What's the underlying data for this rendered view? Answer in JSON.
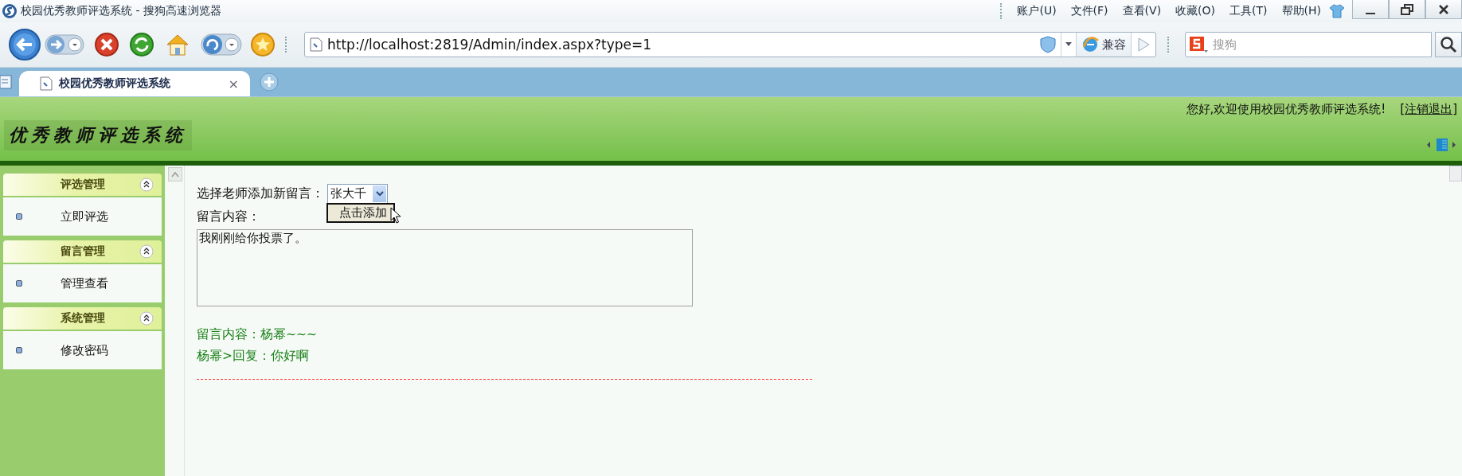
{
  "window": {
    "title": "校园优秀教师评选系统 - 搜狗高速浏览器",
    "menu": [
      "账户(U)",
      "文件(F)",
      "查看(V)",
      "收藏(O)",
      "工具(T)",
      "帮助(H)"
    ]
  },
  "toolbar": {
    "address": "http://localhost:2819/Admin/index.aspx?type=1",
    "compat_button": "兼容",
    "search_placeholder": "搜狗"
  },
  "tabs": [
    {
      "label": "校园优秀教师评选系统",
      "selected": true,
      "close": "×"
    }
  ],
  "header": {
    "logo": "优秀教师评选系统",
    "greeting": "您好,欢迎使用校园优秀教师评选系统!",
    "logout_link": "[注销退出]"
  },
  "sidebar": {
    "sections": [
      {
        "title": "评选管理",
        "expanded": true,
        "items": [
          {
            "label": "立即评选"
          }
        ]
      },
      {
        "title": "留言管理",
        "expanded": true,
        "items": [
          {
            "label": "管理查看"
          }
        ]
      },
      {
        "title": "系统管理",
        "expanded": true,
        "items": [
          {
            "label": "修改密码"
          }
        ]
      }
    ]
  },
  "form": {
    "teacher_label": "选择老师添加新留言：",
    "teacher_select": "张大千",
    "add_button": "点击添加",
    "message_label": "留言内容：",
    "message_value": "我刚刚给你投票了。"
  },
  "messages": [
    {
      "text": "留言内容：杨幂~~~"
    },
    {
      "text": "杨幂>回复：你好啊"
    }
  ]
}
